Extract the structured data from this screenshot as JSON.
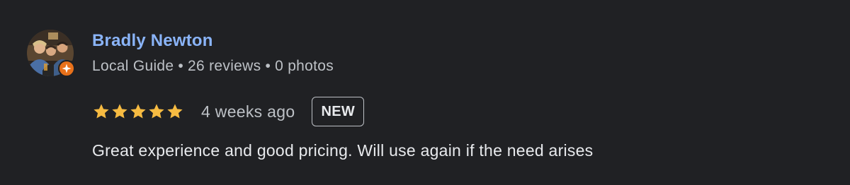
{
  "review": {
    "reviewer": {
      "name": "Bradly Newton",
      "role": "Local Guide",
      "reviews": "26 reviews",
      "photos": "0 photos",
      "separator": "•",
      "avatar_icon": "profile-photo",
      "badge_icon": "local-guide-star-icon",
      "badge_color": "#e8711a"
    },
    "rating": {
      "stars": 5,
      "max_stars": 5,
      "star_color": "#f6bb42"
    },
    "age": "4 weeks ago",
    "badge": "NEW",
    "text": "Great experience and good pricing. Will use again if the need arises"
  },
  "colors": {
    "background": "#202124",
    "name": "#8ab4f8",
    "secondary_text": "#bdc1c6",
    "primary_text": "#e8eaed"
  }
}
